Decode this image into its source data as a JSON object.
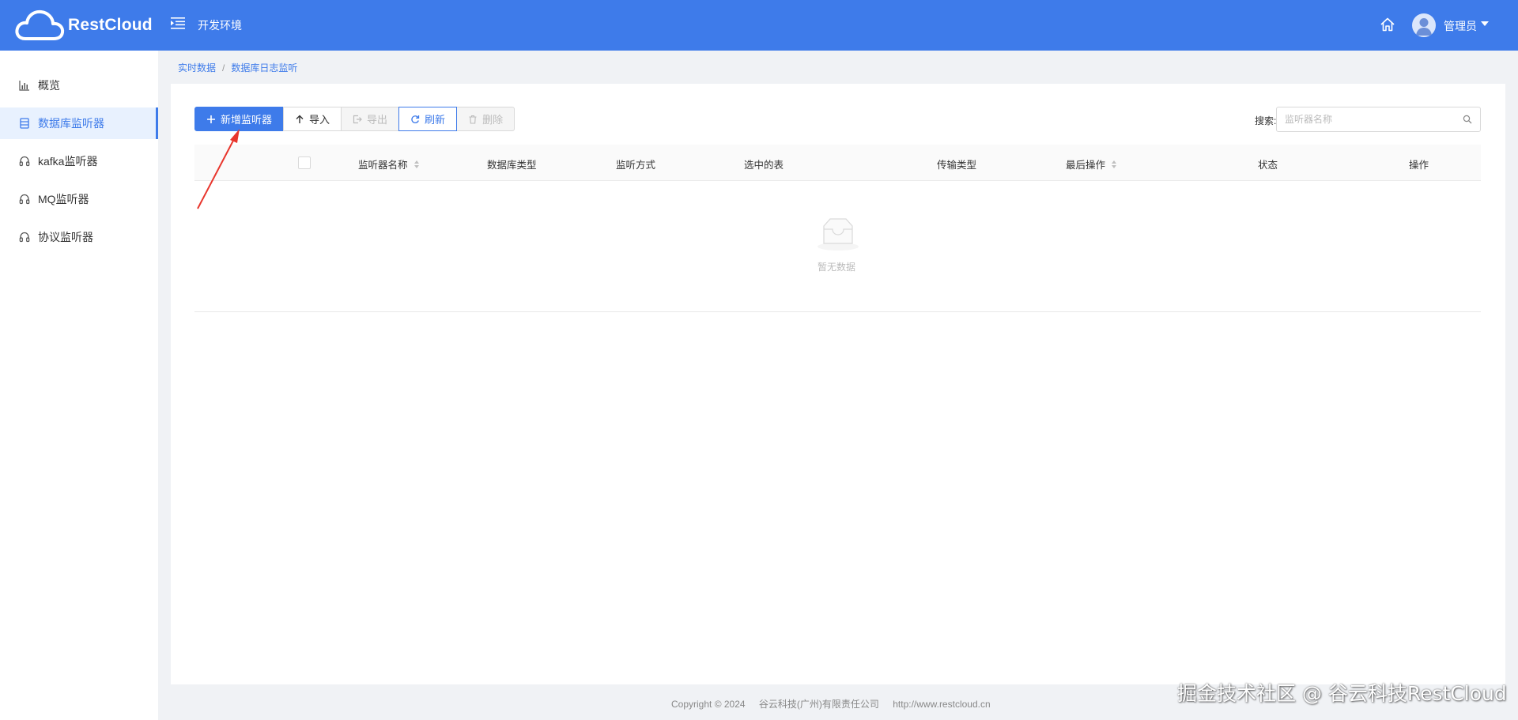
{
  "header": {
    "logo_text": "RestCloud",
    "env_label": "开发环境",
    "user_name": "管理员"
  },
  "sidebar": {
    "items": [
      {
        "label": "概览",
        "icon": "bar-chart-icon",
        "active": false
      },
      {
        "label": "数据库监听器",
        "icon": "database-icon",
        "active": true
      },
      {
        "label": "kafka监听器",
        "icon": "headset-icon",
        "active": false
      },
      {
        "label": "MQ监听器",
        "icon": "headset-icon",
        "active": false
      },
      {
        "label": "协议监听器",
        "icon": "headset-icon",
        "active": false
      }
    ]
  },
  "breadcrumb": {
    "items": [
      "实时数据",
      "数据库日志监听"
    ],
    "separator": "/"
  },
  "toolbar": {
    "add_label": "新增监听器",
    "import_label": "导入",
    "export_label": "导出",
    "refresh_label": "刷新",
    "delete_label": "删除"
  },
  "search": {
    "label": "搜索:",
    "placeholder": "监听器名称"
  },
  "table": {
    "columns": [
      "监听器名称",
      "数据库类型",
      "监听方式",
      "选中的表",
      "传输类型",
      "最后操作",
      "状态",
      "操作"
    ],
    "sortable_columns": [
      "监听器名称",
      "最后操作"
    ],
    "rows": [],
    "empty_text": "暂无数据"
  },
  "footer": {
    "copyright": "Copyright © 2024",
    "company": "谷云科技(广州)有限责任公司",
    "url": "http://www.restcloud.cn"
  },
  "watermark": "掘金技术社区 @ 谷云科技RestCloud",
  "colors": {
    "brand": "#3e7bea",
    "arrow": "#e8352c"
  }
}
